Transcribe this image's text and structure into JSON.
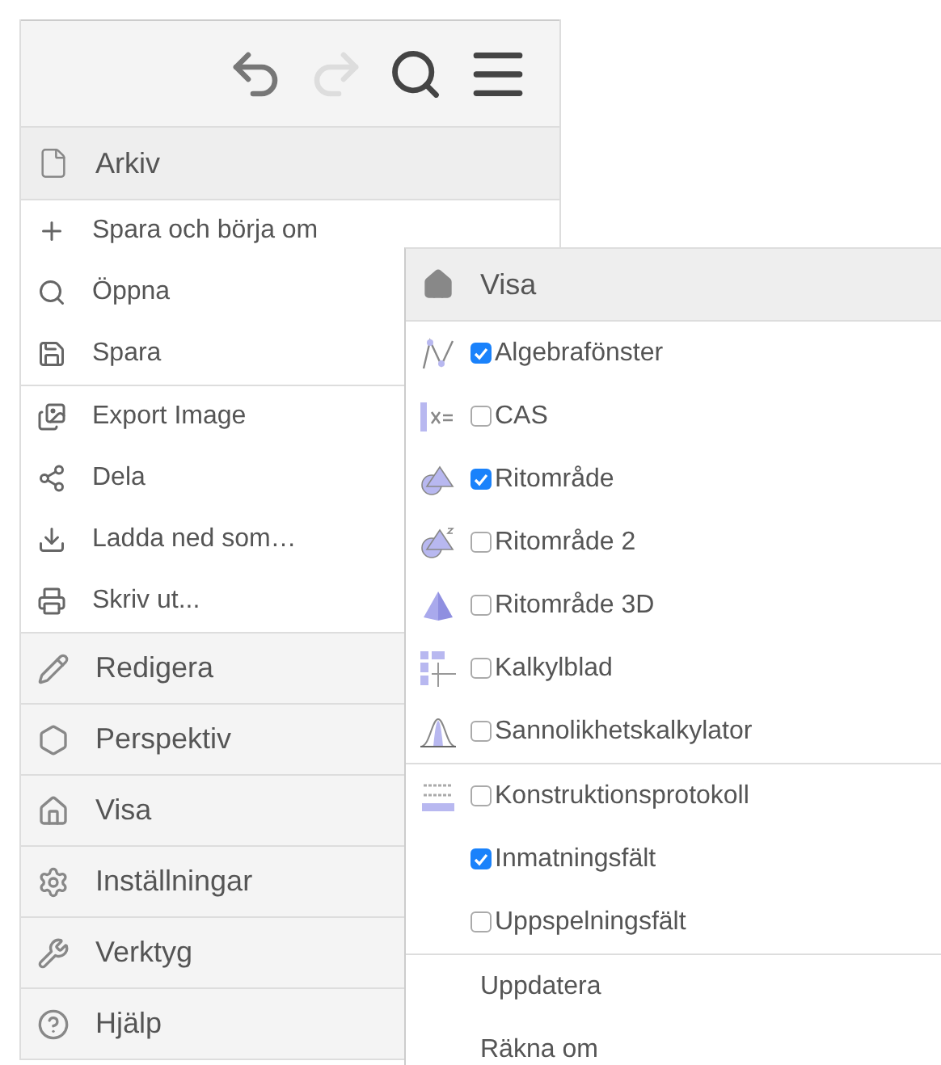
{
  "toolbar": {
    "undo_enabled": true,
    "redo_enabled": false
  },
  "menu": {
    "header": "Arkiv",
    "groups": [
      [
        "Spara och börja om",
        "Öppna",
        "Spara"
      ],
      [
        "Export Image",
        "Dela",
        "Ladda ned som…",
        "Skriv ut..."
      ]
    ],
    "sections": [
      "Redigera",
      "Perspektiv",
      "Visa",
      "Inställningar",
      "Verktyg",
      "Hjälp"
    ]
  },
  "submenu": {
    "header": "Visa",
    "groups": [
      [
        {
          "kind": "checkbox",
          "label": "Algebrafönster",
          "checked": true
        },
        {
          "kind": "checkbox",
          "label": "CAS",
          "checked": false
        },
        {
          "kind": "checkbox",
          "label": "Ritområde",
          "checked": true
        },
        {
          "kind": "checkbox",
          "label": "Ritområde 2",
          "checked": false
        },
        {
          "kind": "checkbox",
          "label": "Ritområde 3D",
          "checked": false
        },
        {
          "kind": "checkbox",
          "label": "Kalkylblad",
          "checked": false
        },
        {
          "kind": "checkbox",
          "label": "Sannolikhetskalkylator",
          "checked": false
        }
      ],
      [
        {
          "kind": "checkbox",
          "label": "Konstruktionsprotokoll",
          "checked": false
        },
        {
          "kind": "checkbox",
          "label": "Inmatningsfält",
          "checked": true
        },
        {
          "kind": "checkbox",
          "label": "Uppspelningsfält",
          "checked": false
        }
      ],
      [
        {
          "kind": "action",
          "label": "Uppdatera"
        },
        {
          "kind": "action",
          "label": "Räkna om"
        }
      ]
    ]
  }
}
